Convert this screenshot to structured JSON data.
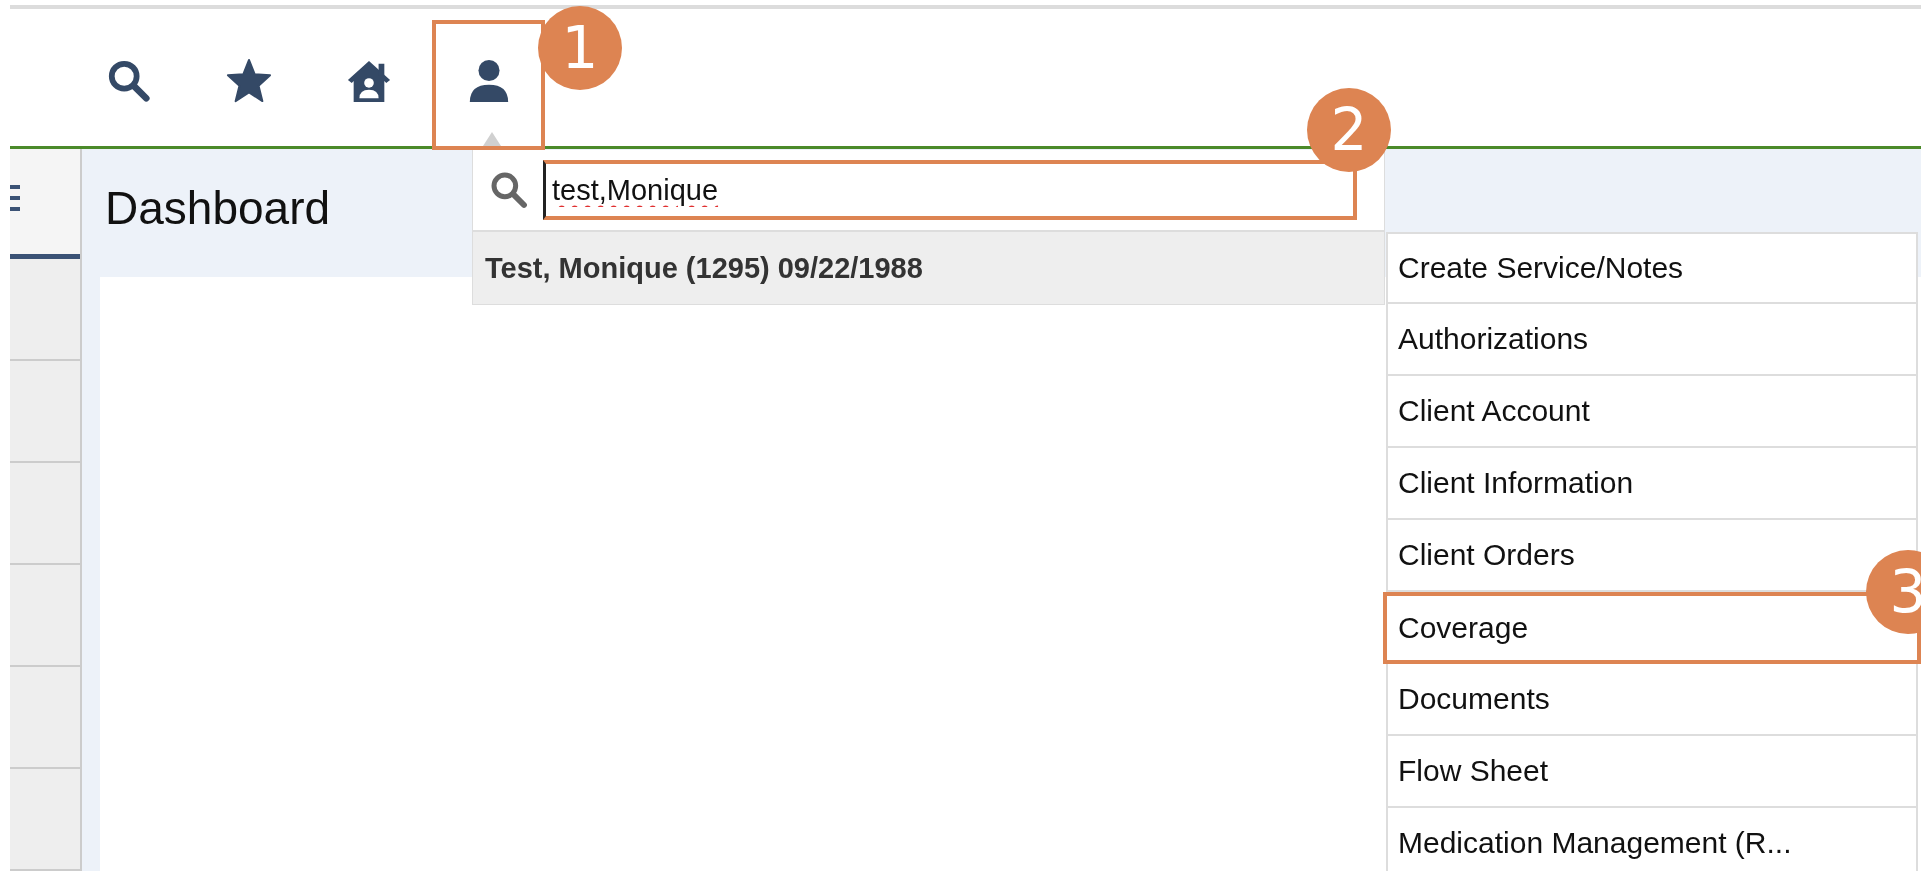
{
  "toolbar": {
    "items": [
      {
        "kind": "search",
        "highlighted": false
      },
      {
        "kind": "star",
        "highlighted": false
      },
      {
        "kind": "home",
        "highlighted": false
      },
      {
        "kind": "person",
        "highlighted": true,
        "badge": "1"
      }
    ]
  },
  "page": {
    "title": "Dashboard"
  },
  "client_search": {
    "value": "test,Monique",
    "highlighted": true,
    "badge": "2",
    "results": [
      "Test, Monique (1295) 09/22/1988"
    ]
  },
  "client_menu": {
    "items": [
      {
        "label": "Create Service/Notes",
        "highlighted": false
      },
      {
        "label": "Authorizations",
        "highlighted": false
      },
      {
        "label": "Client Account",
        "highlighted": false
      },
      {
        "label": "Client Information",
        "highlighted": false
      },
      {
        "label": "Client Orders",
        "highlighted": false
      },
      {
        "label": "Coverage",
        "highlighted": true,
        "badge": "3"
      },
      {
        "label": "Documents",
        "highlighted": false
      },
      {
        "label": "Flow Sheet",
        "highlighted": false
      },
      {
        "label": "Medication Management (R...",
        "highlighted": false
      }
    ]
  }
}
